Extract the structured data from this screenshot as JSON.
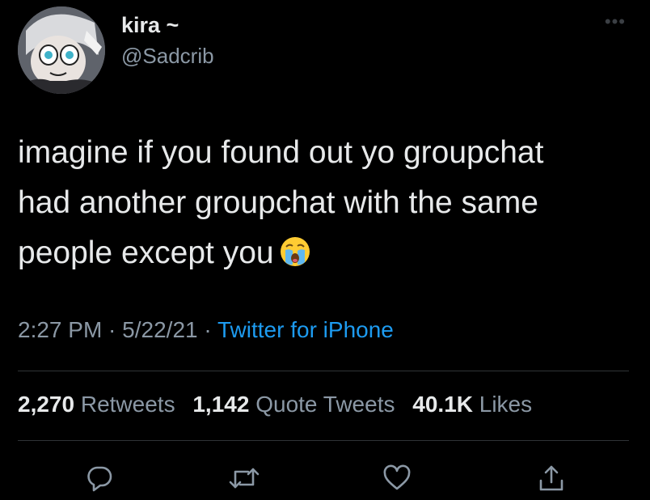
{
  "user": {
    "name": "kira ~",
    "handle": "@Sadcrib"
  },
  "tweet": {
    "lines": [
      "imagine if you found out yo groupchat",
      "had another groupchat with the same",
      "people except you"
    ],
    "emoji": "crying-face-emoji"
  },
  "meta": {
    "time": "2:27 PM",
    "sep1": " · ",
    "date": "5/22/21",
    "sep2": " · ",
    "source": "Twitter for iPhone"
  },
  "stats": {
    "retweets_count": "2,270",
    "retweets_label": "Retweets",
    "quotes_count": "1,142",
    "quotes_label": "Quote Tweets",
    "likes_count": "40.1K",
    "likes_label": "Likes"
  },
  "icons": {
    "more": "more-icon",
    "reply": "reply-icon",
    "retweet": "retweet-icon",
    "like": "heart-icon",
    "share": "share-icon"
  },
  "colors": {
    "background": "#000000",
    "text": "#e7e9ea",
    "secondary": "#8b98a5",
    "link": "#1d9bf0"
  }
}
